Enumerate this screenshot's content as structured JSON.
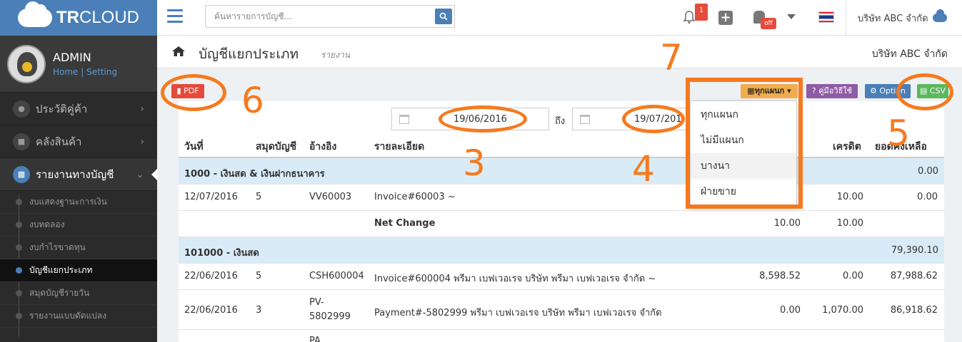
{
  "app": {
    "logo_prefix": "TR",
    "logo_suffix": "CLOUD"
  },
  "profile": {
    "name": "ADMIN",
    "home_link": "Home",
    "separator": "|",
    "setting_link": "Setting"
  },
  "sidebar": {
    "items": [
      {
        "label": "ประวัติคู่ค้า",
        "icon": "users-icon"
      },
      {
        "label": "คลังสินค้า",
        "icon": "truck-icon"
      },
      {
        "label": "รายงานทางบัญชี",
        "icon": "report-icon"
      }
    ],
    "subitems": [
      "งบแสดงฐานะการเงิน",
      "งบทดลอง",
      "งบกำไรขาดทุน",
      "บัญชีแยกประเภท",
      "สมุดบัญชีรายวัน",
      "รายงานแบบดัดแปลง"
    ]
  },
  "topbar": {
    "search_placeholder": "ค้นหารายการบัญชี...",
    "notification_count": "1",
    "android_status": "off",
    "company": "บริษัท ABC จำกัด"
  },
  "page": {
    "title": "บัญชีแยกประเภท",
    "subtitle": "รายงาน",
    "company": "บริษัท ABC จำกัด"
  },
  "toolbar": {
    "pdf": "PDF",
    "department": "ทุกแผนก",
    "guide": "คู่มือวิธีใช้",
    "option": "Option",
    "csv": "CSV"
  },
  "filters": {
    "date_from": "19/06/2016",
    "to_label": "ถึง",
    "date_to": "19/07/201"
  },
  "department_options": [
    "ทุกแผนก",
    "ไม่มีแผนก",
    "บางนา",
    "ฝ่ายขาย"
  ],
  "table": {
    "columns": [
      "วันที่",
      "สมุดบัญชี",
      "อ้างอิง",
      "รายละเอียด",
      "เครดิต",
      "ยอดคงเหลือ"
    ],
    "groups": [
      {
        "label": "1000 - เงินสด & เงินฝากธนาคาร",
        "balance": "0.00"
      },
      {
        "label": "101000 - เงินสด",
        "balance": "79,390.10"
      }
    ],
    "rows": [
      {
        "date": "12/07/2016",
        "book": "5",
        "ref": "VV60003",
        "detail": "Invoice#60003 ~",
        "debit": "",
        "credit": "10.00",
        "balance": "0.00"
      },
      {
        "detail": "Net Change",
        "debit": "10.00",
        "credit": "10.00"
      },
      {
        "date": "22/06/2016",
        "book": "5",
        "ref": "CSH600004",
        "detail": "Invoice#600004 พรีมา เบฟเวอเรจ บริษัท พรีมา เบฟเวอเรจ จำกัด ~",
        "debit": "8,598.52",
        "credit": "0.00",
        "balance": "87,988.62"
      },
      {
        "date": "22/06/2016",
        "book": "3",
        "ref_line1": "PV-",
        "ref_line2": "5802999",
        "detail": "Payment#-5802999 พรีมา เบฟเวอเรจ บริษัท พรีมา เบฟเวอเรจ จำกัด",
        "debit": "0.00",
        "credit": "1,070.00",
        "balance": "86,918.62"
      },
      {
        "ref_line1": "PA"
      }
    ]
  },
  "annotations": {
    "n3": "3",
    "n4": "4",
    "n5": "5",
    "n6": "6",
    "n7": "7"
  },
  "colors": {
    "brand": "#4a7fb8",
    "annotation": "#f57a1f",
    "pdf": "#e54b3c",
    "department": "#f0ad4e",
    "guide": "#8e5ba4",
    "csv": "#5cb85c",
    "group_row": "#d9ebf6"
  }
}
